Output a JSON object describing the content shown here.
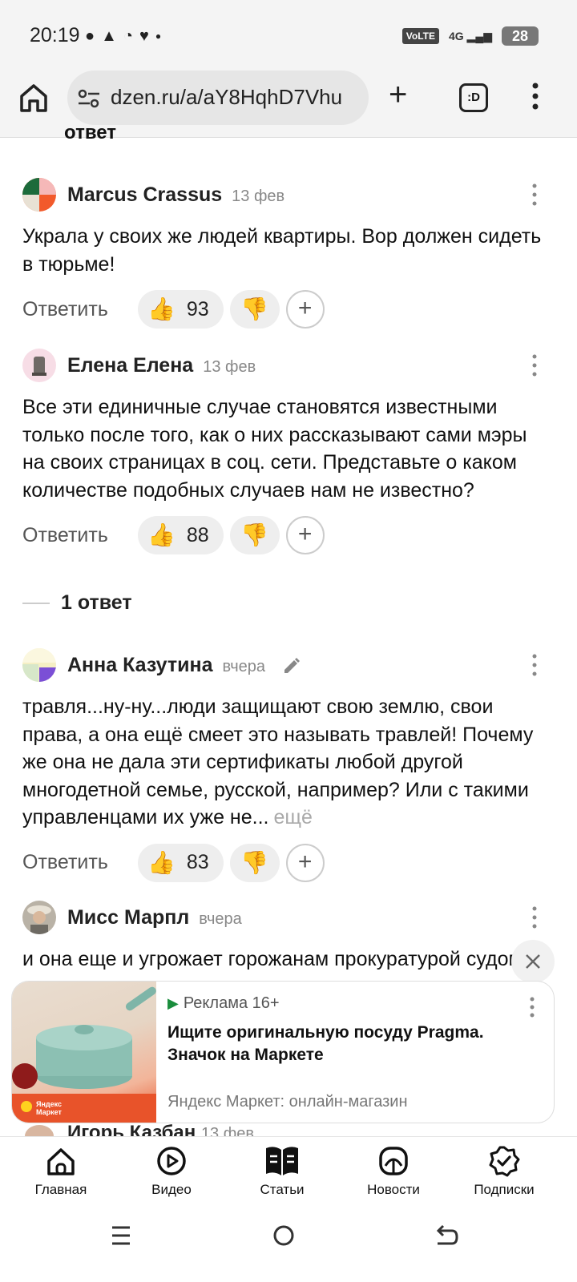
{
  "status_bar": {
    "time": "20:19",
    "network": "4G",
    "volte": "VoLTE",
    "battery": "28"
  },
  "browser": {
    "url": "dzen.ru/a/aY8HqhD7Vhu",
    "tabs_label": ":D"
  },
  "partial_top": "ответ",
  "comments": [
    {
      "author": "Marcus Crassus",
      "date": "13 фев",
      "text": "Украла у своих же людей квартиры. Вор должен сидеть в тюрьме!",
      "reply_label": "Ответить",
      "likes": "93"
    },
    {
      "author": "Елена Елена",
      "date": "13 фев",
      "text": "Все эти единичные случае становятся известными только после того, как о них рассказывают сами мэры на своих страницах в соц. сети. Представьте о каком количестве подобных случаев нам не известно?",
      "reply_label": "Ответить",
      "likes": "88",
      "replies": "1 ответ"
    },
    {
      "author": "Анна Казутина",
      "date": "вчера",
      "text": "травля...ну-ну...люди защищают свою землю, свои права, а она ещё смеет это называть травлей! Почему же она не дала эти сертификаты любой другой многодетной семье, русской, например? Или с такими управленцами их уже не...",
      "more": "ещё",
      "reply_label": "Ответить",
      "likes": "83"
    },
    {
      "author": "Мисс Марпл",
      "date": "вчера",
      "text": "и она еще и угрожает горожанам прокуратурой судом! совсем берега потеряла!"
    }
  ],
  "ad": {
    "label": "Реклама 16+",
    "title": "Ищите оригинальную посуду Pragma. Значок на Маркете",
    "source": "Яндекс Маркет: онлайн-магазин",
    "brand": "Яндекс Маркет"
  },
  "partial_bottom": {
    "author": "Игорь Казбан",
    "date": "13 фев"
  },
  "bottom_nav": [
    {
      "label": "Главная"
    },
    {
      "label": "Видео"
    },
    {
      "label": "Статьи"
    },
    {
      "label": "Новости"
    },
    {
      "label": "Подписки"
    }
  ]
}
